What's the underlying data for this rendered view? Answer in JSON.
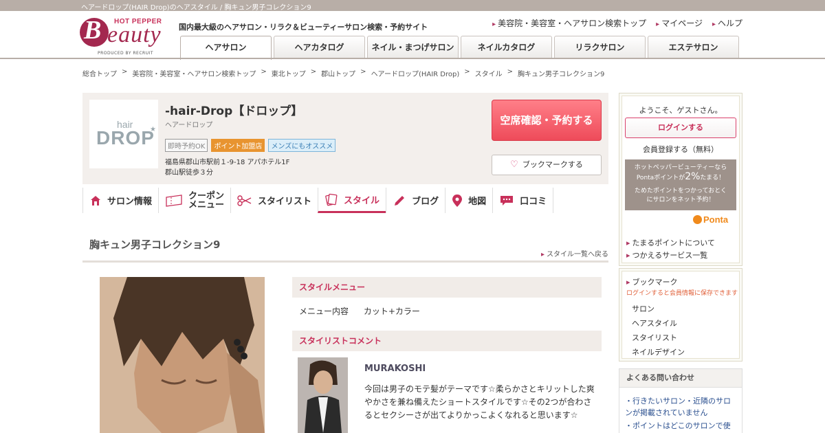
{
  "top_strip": "ヘアードロップ(HAIR Drop)のヘアスタイル / 胸キュン男子コレクション9",
  "logo": {
    "hp": "HOT PEPPER",
    "b": "B",
    "word": "eauty",
    "produced": "PRODUCED BY RECRUIT"
  },
  "tagline": "国内最大級のヘアサロン・リラク＆ビューティーサロン検索・予約サイト",
  "top_links": [
    "美容院・美容室・ヘアサロン検索トップ",
    "マイページ",
    "ヘルプ"
  ],
  "global_nav": [
    "ヘアサロン",
    "ヘアカタログ",
    "ネイル・まつげサロン",
    "ネイルカタログ",
    "リラクサロン",
    "エステサロン"
  ],
  "breadcrumb": [
    "総合トップ",
    "美容院・美容室・ヘアサロン検索トップ",
    "東北トップ",
    "郡山トップ",
    "ヘアードロップ(HAIR Drop)",
    "スタイル",
    "胸キュン男子コレクション9"
  ],
  "breadcrumb_sep": ">",
  "salon": {
    "logo_hair": "hair",
    "logo_drop": "DROP",
    "name": "-hair-Drop【ドロップ】",
    "kana": "ヘアードロップ",
    "badges": [
      "即時予約OK",
      "ポイント加盟店",
      "メンズにもオススメ"
    ],
    "address": "福島県郡山市駅前１-9-18 アパホテル1F",
    "access": "郡山駅徒歩３分"
  },
  "reserve_button": "空席確認・予約する",
  "bookmark_button": "ブックマークする",
  "sub_nav": [
    {
      "label": "サロン情報",
      "icon": "home-icon"
    },
    {
      "label": "クーポン",
      "label2": "メニュー",
      "icon": "coupon-icon"
    },
    {
      "label": "スタイリスト",
      "icon": "scissors-icon"
    },
    {
      "label": "スタイル",
      "icon": "style-card-icon"
    },
    {
      "label": "ブログ",
      "icon": "pencil-icon"
    },
    {
      "label": "地図",
      "icon": "map-pin-icon"
    },
    {
      "label": "口コミ",
      "icon": "speech-bubble-icon"
    }
  ],
  "page_title": "胸キュン男子コレクション9",
  "back_link": "スタイル一覧へ戻る",
  "style_menu": {
    "heading": "スタイルメニュー",
    "key": "メニュー内容",
    "value": "カット+カラー"
  },
  "stylist_comment": {
    "heading": "スタイリストコメント",
    "name": "MURAKOSHI",
    "text": "今回は男子のモテ髪がテーマです☆柔らかさとキリットした爽やかさを兼ね備えたショートスタイルです☆その2つが合わさるとセクシーさが出てよりかっこよくなれると思います☆"
  },
  "sidebar": {
    "welcome": "ようこそ、ゲストさん。",
    "login": "ログインする",
    "register": "会員登録する（無料）",
    "ponta_line1": "ホットペッパービューティーなら",
    "ponta_line2a": "Pontaポイントが",
    "ponta_percent": "2%",
    "ponta_line2b": "たまる！",
    "ponta_line3": "ためたポイントをつかっておとく",
    "ponta_line4": "にサロンをネット予約！",
    "ponta_logo": "Ponta",
    "links": [
      "たまるポイントについて",
      "つかえるサービス一覧"
    ],
    "bookmark_title": "ブックマーク",
    "bookmark_note": "ログインすると会員情報に保存できます",
    "bookmark_items": [
      "サロン",
      "ヘアスタイル",
      "スタイリスト",
      "ネイルデザイン"
    ],
    "faq_title": "よくある問い合わせ",
    "faq_items": [
      "行きたいサロン・近隣のサロンが掲載されていません",
      "ポイントはどこのサロンで使"
    ]
  },
  "colors": {
    "brand": "#c8305a",
    "reserve": "#ee4b5a",
    "strip": "#b8aea7"
  }
}
